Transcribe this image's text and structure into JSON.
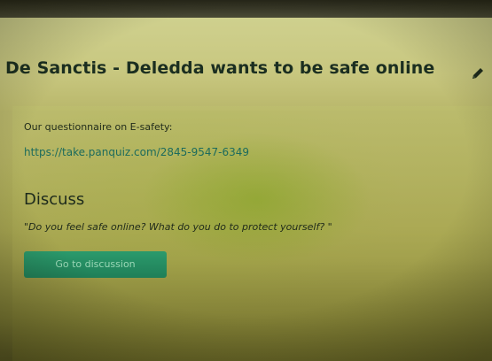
{
  "header": {
    "title": "De Sanctis - Deledda wants to be safe online",
    "edit_icon": "pencil-icon"
  },
  "questionnaire": {
    "label": "Our questionnaire on E-safety:",
    "link": "https://take.panquiz.com/2845-9547-6349"
  },
  "discussion": {
    "heading": "Discuss",
    "question": "\"Do you feel safe online? What do you do to protect yourself? \"",
    "button_label": "Go to discussion"
  },
  "colors": {
    "title_text": "#1b2e20",
    "link": "#1d6b5c",
    "button_bg": "#1f7f58",
    "button_text": "#9ad7b6"
  }
}
